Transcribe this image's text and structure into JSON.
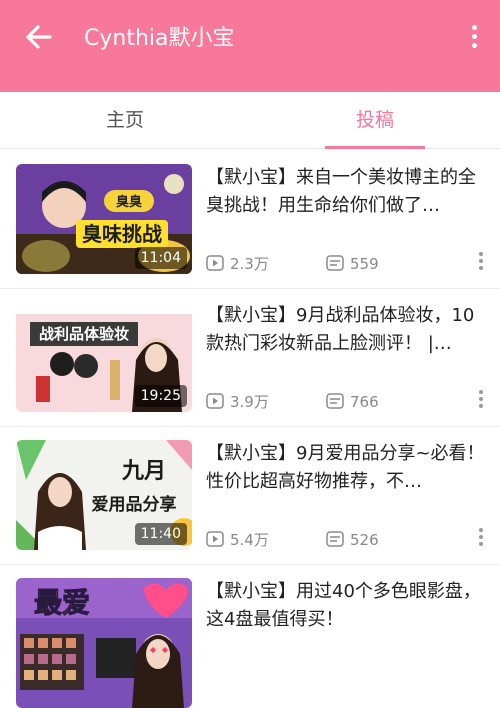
{
  "header": {
    "title": "Cynthia默小宝",
    "back_icon": "arrow-left-icon",
    "more_icon": "more-vertical-icon",
    "color": "#f7789a"
  },
  "tabs": [
    {
      "label": "主页",
      "active": false
    },
    {
      "label": "投稿",
      "active": true
    }
  ],
  "videos": [
    {
      "title": "【默小宝】来自一个美妆博主的全臭挑战！用生命给你们做了…",
      "thumb_text": "臭味挑战",
      "thumb_badge": "臭臭",
      "duration": "11:04",
      "plays": "2.3万",
      "danmaku": "559"
    },
    {
      "title": "【默小宝】9月战利品体验妆，10款热门彩妆新品上脸测评！ |…",
      "thumb_text": "战利品体验妆",
      "duration": "19:25",
      "plays": "3.9万",
      "danmaku": "766"
    },
    {
      "title": "【默小宝】9月爱用品分享~必看！性价比超高好物推荐，不…",
      "thumb_text_1": "九月",
      "thumb_text_2": "爱用品分享",
      "duration": "11:40",
      "plays": "5.4万",
      "danmaku": "526"
    },
    {
      "title": "【默小宝】用过40个多色眼影盘，这4盘最值得买！",
      "thumb_text": "最爱"
    }
  ]
}
